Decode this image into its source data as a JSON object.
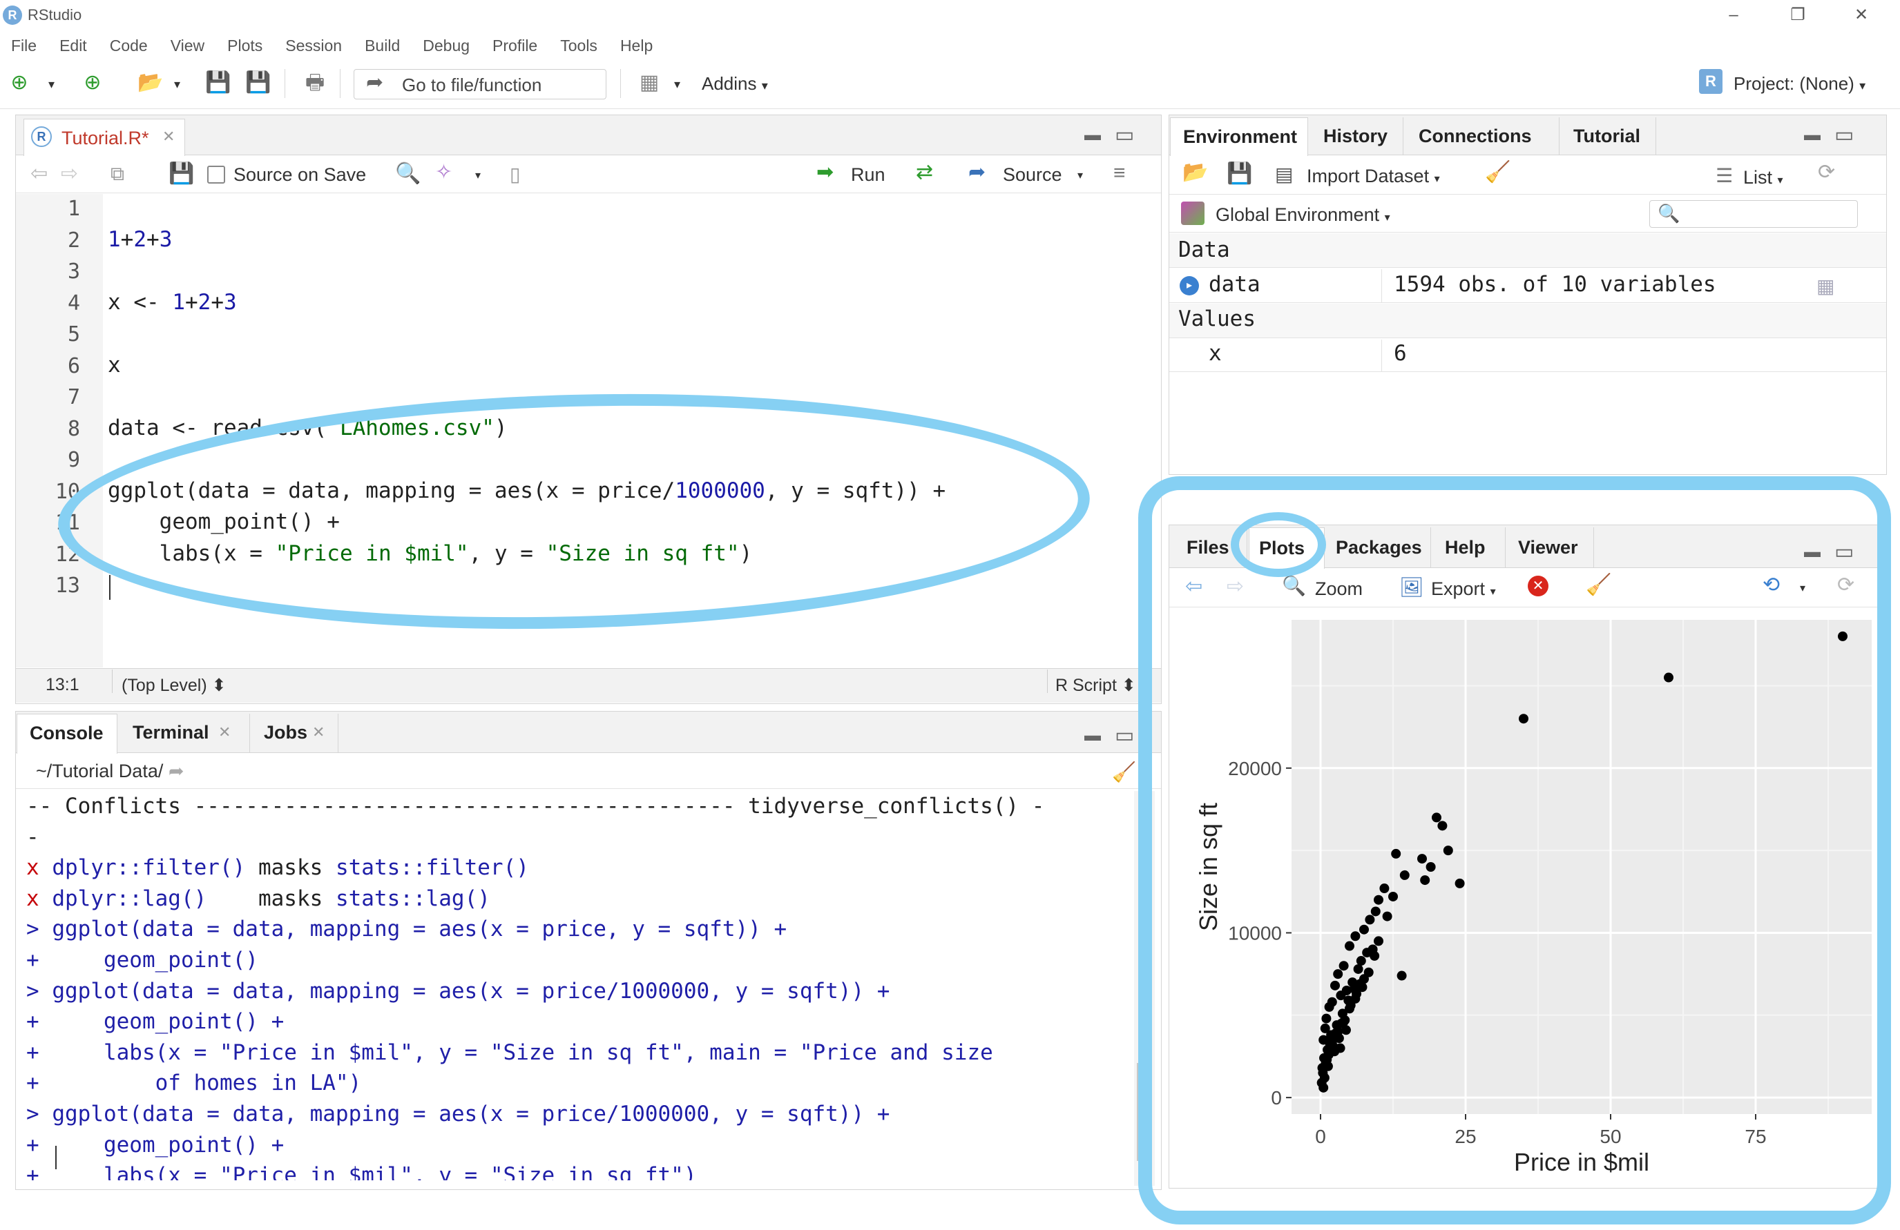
{
  "window": {
    "title": "RStudio",
    "logo_letter": "R",
    "controls": [
      "–",
      "❐",
      "✕"
    ]
  },
  "menu": [
    "File",
    "Edit",
    "Code",
    "View",
    "Plots",
    "Session",
    "Build",
    "Debug",
    "Profile",
    "Tools",
    "Help"
  ],
  "toolbar": {
    "goto_label": "Go to file/function",
    "addins_label": "Addins",
    "project_label": "Project: (None)"
  },
  "editor": {
    "tab_label": "Tutorial.R*",
    "source_on_save": "Source on Save",
    "run_label": "Run",
    "source_label": "Source",
    "line_numbers": [
      "1",
      "2",
      "3",
      "4",
      "5",
      "6",
      "7",
      "8",
      "9",
      "10",
      "11",
      "12",
      "13"
    ],
    "lines": [
      "",
      "1+2+3",
      "",
      "x <- 1+2+3",
      "",
      "x",
      "",
      "data <- read.csv(\"LAhomes.csv\")",
      "",
      "ggplot(data = data, mapping = aes(x = price/1000000, y = sqft)) +",
      "    geom_point() +",
      "    labs(x = \"Price in $mil\", y = \"Size in sq ft\")",
      ""
    ],
    "status_position": "13:1",
    "status_scope": "(Top Level)",
    "status_type": "R Script"
  },
  "console": {
    "tabs": [
      "Console",
      "Terminal",
      "Jobs"
    ],
    "path": "~/Tutorial Data/",
    "lines": [
      {
        "text": "-- Conflicts ------------------------------------------ tidyverse_conflicts() -",
        "style": "con-dark"
      },
      {
        "text": "-",
        "style": "con-dark"
      },
      {
        "text": "x dplyr::filter() masks stats::filter()",
        "style": "mix"
      },
      {
        "text": "x dplyr::lag()    masks stats::lag()",
        "style": "mix"
      },
      {
        "text": "> ggplot(data = data, mapping = aes(x = price, y = sqft)) +",
        "style": "con-blue"
      },
      {
        "text": "+     geom_point()",
        "style": "con-blue"
      },
      {
        "text": "> ggplot(data = data, mapping = aes(x = price/1000000, y = sqft)) +",
        "style": "con-blue"
      },
      {
        "text": "+     geom_point() +",
        "style": "con-blue"
      },
      {
        "text": "+     labs(x = \"Price in $mil\", y = \"Size in sq ft\", main = \"Price and size",
        "style": "con-blue"
      },
      {
        "text": "+         of homes in LA\")",
        "style": "con-blue"
      },
      {
        "text": "> ggplot(data = data, mapping = aes(x = price/1000000, y = sqft)) +",
        "style": "con-blue"
      },
      {
        "text": "+     geom_point() +",
        "style": "con-blue"
      },
      {
        "text": "+     labs(x = \"Price in $mil\", y = \"Size in sq ft\")",
        "style": "con-blue"
      },
      {
        "text": ">",
        "style": "con-blue"
      }
    ]
  },
  "environment": {
    "tabs": [
      "Environment",
      "History",
      "Connections",
      "Tutorial"
    ],
    "import_label": "Import Dataset",
    "list_label": "List",
    "scope_label": "Global Environment",
    "section_data": "Data",
    "section_values": "Values",
    "data_name": "data",
    "data_value": "1594 obs. of 10 variables",
    "value_name": "x",
    "value_value": "6"
  },
  "files": {
    "tabs": [
      "Files",
      "Plots",
      "Packages",
      "Help",
      "Viewer"
    ],
    "zoom_label": "Zoom",
    "export_label": "Export"
  },
  "chart_data": {
    "type": "scatter",
    "xlabel": "Price in $mil",
    "ylabel": "Size in sq ft",
    "xlim": [
      -5,
      95
    ],
    "ylim": [
      -1000,
      29000
    ],
    "xticks": [
      0,
      25,
      50,
      75
    ],
    "yticks": [
      0,
      10000,
      20000
    ],
    "xtick_labels": [
      "0",
      "25",
      "50",
      "75"
    ],
    "ytick_labels": [
      "0",
      "10000",
      "20000"
    ],
    "grid": true,
    "series": [
      {
        "x": [
          90,
          60,
          35,
          20,
          21,
          22,
          13,
          19,
          17.5,
          18,
          24,
          14.5,
          11,
          12.5,
          10,
          9.5,
          11.5,
          8.5,
          7.5,
          14,
          6,
          10,
          9,
          5,
          8,
          7,
          4,
          6.5,
          3,
          5.5,
          2.5,
          4.5,
          3.5,
          2,
          1.5,
          1,
          0.8,
          0.5,
          6,
          7.5,
          5,
          4,
          3,
          2,
          1.2,
          0.6,
          0.3,
          3.8,
          2.8,
          1.8,
          4.8,
          5.8,
          6.8,
          8.3,
          9.3,
          2.2,
          1.4,
          0.9,
          0.4,
          3.2,
          4.2,
          5.2,
          6.2,
          7.2,
          1.6,
          2.6,
          3.6,
          0.7,
          1.1,
          2.4,
          3.4,
          4.4,
          0.2,
          0.5,
          1.3
        ],
        "y": [
          28000,
          25500,
          23000,
          17000,
          16500,
          15000,
          14800,
          14000,
          14500,
          13200,
          13000,
          13500,
          12700,
          12200,
          12000,
          11300,
          11000,
          10800,
          10200,
          7400,
          9800,
          9500,
          9000,
          9200,
          8800,
          8300,
          8000,
          7800,
          7500,
          7000,
          6800,
          6500,
          6200,
          5800,
          5500,
          4800,
          4200,
          3500,
          6000,
          7200,
          5400,
          4600,
          4000,
          3400,
          2900,
          2400,
          1800,
          5100,
          4400,
          3800,
          5900,
          6600,
          6900,
          7600,
          8600,
          3100,
          2600,
          2100,
          1500,
          3600,
          4700,
          5600,
          6300,
          6700,
          3300,
          3900,
          4500,
          1200,
          2300,
          2800,
          3000,
          4100,
          900,
          600,
          1900
        ]
      }
    ]
  }
}
